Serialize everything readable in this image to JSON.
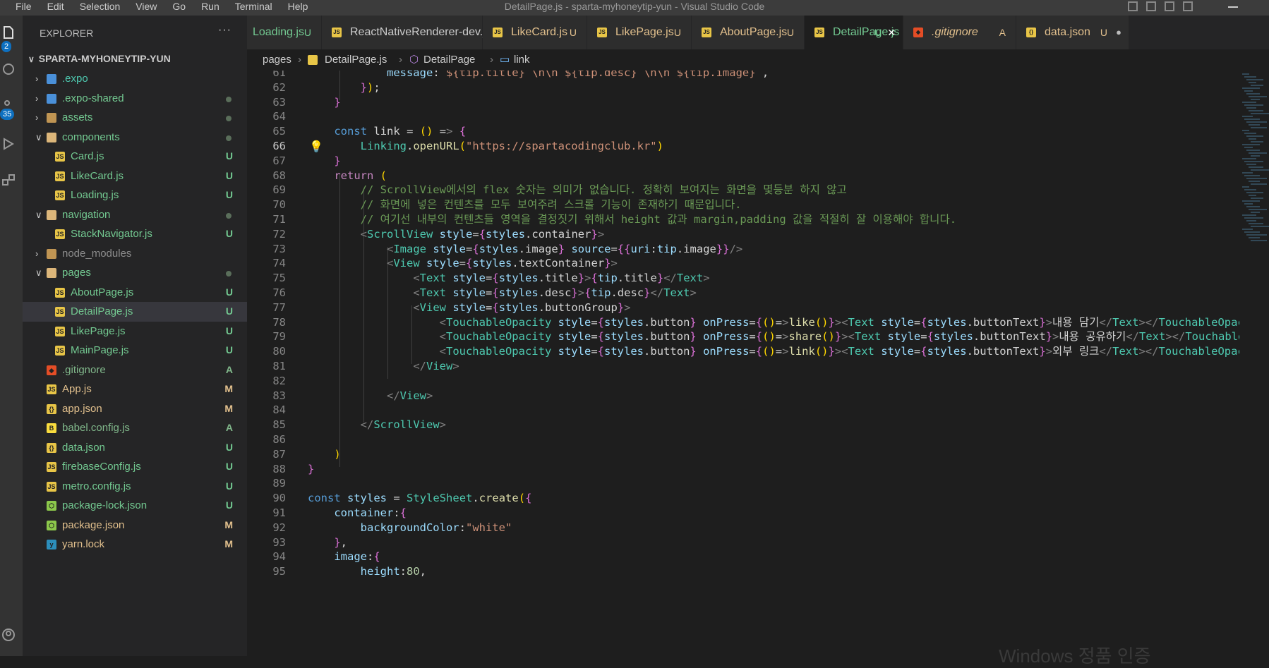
{
  "window": {
    "menu": [
      "File",
      "Edit",
      "Selection",
      "View",
      "Go",
      "Run",
      "Terminal",
      "Help"
    ],
    "title": "DetailPage.js - sparta-myhoneytip-yun - Visual Studio Code"
  },
  "activity_bar": {
    "explorer_badge": "2",
    "scm_badge": "35"
  },
  "sidebar": {
    "header": "EXPLORER",
    "more": "···",
    "project": "SPARTA-MYHONEYTIP-YUN",
    "items": [
      {
        "label": ".expo",
        "status": "",
        "dot": false,
        "color": "#4ec9b0",
        "icon": "expo-folder-icon"
      },
      {
        "label": ".expo-shared",
        "status": "",
        "dot": true,
        "color": "#73c991",
        "icon": "expo-folder-icon"
      },
      {
        "label": "assets",
        "status": "",
        "dot": true,
        "color": "#73c991",
        "icon": "folder-icon"
      },
      {
        "label": "components",
        "status": "",
        "dot": true,
        "color": "#73c991",
        "icon": "folder-open-icon"
      },
      {
        "label": "Card.js",
        "status": "U",
        "dot": false,
        "color": "#73c991",
        "icon": "js-file-icon"
      },
      {
        "label": "LikeCard.js",
        "status": "U",
        "dot": false,
        "color": "#73c991",
        "icon": "js-file-icon"
      },
      {
        "label": "Loading.js",
        "status": "U",
        "dot": false,
        "color": "#73c991",
        "icon": "js-file-icon"
      },
      {
        "label": "navigation",
        "status": "",
        "dot": true,
        "color": "#73c991",
        "icon": "folder-open-icon"
      },
      {
        "label": "StackNavigator.js",
        "status": "U",
        "dot": false,
        "color": "#73c991",
        "icon": "js-file-icon"
      },
      {
        "label": "node_modules",
        "status": "",
        "dot": false,
        "color": "#8c8c8c",
        "icon": "folder-icon"
      },
      {
        "label": "pages",
        "status": "",
        "dot": true,
        "color": "#73c991",
        "icon": "folder-open-icon"
      },
      {
        "label": "AboutPage.js",
        "status": "U",
        "dot": false,
        "color": "#73c991",
        "icon": "js-file-icon"
      },
      {
        "label": "DetailPage.js",
        "status": "U",
        "dot": false,
        "color": "#73c991",
        "icon": "js-file-icon"
      },
      {
        "label": "LikePage.js",
        "status": "U",
        "dot": false,
        "color": "#73c991",
        "icon": "js-file-icon"
      },
      {
        "label": "MainPage.js",
        "status": "U",
        "dot": false,
        "color": "#73c991",
        "icon": "js-file-icon"
      },
      {
        "label": ".gitignore",
        "status": "A",
        "dot": false,
        "color": "#81b88b",
        "icon": "git-icon"
      },
      {
        "label": "App.js",
        "status": "M",
        "dot": false,
        "color": "#e2c08d",
        "icon": "js-file-icon"
      },
      {
        "label": "app.json",
        "status": "M",
        "dot": false,
        "color": "#e2c08d",
        "icon": "json-file-icon"
      },
      {
        "label": "babel.config.js",
        "status": "A",
        "dot": false,
        "color": "#81b88b",
        "icon": "babel-icon"
      },
      {
        "label": "data.json",
        "status": "U",
        "dot": false,
        "color": "#73c991",
        "icon": "json-file-icon"
      },
      {
        "label": "firebaseConfig.js",
        "status": "U",
        "dot": false,
        "color": "#73c991",
        "icon": "js-file-icon"
      },
      {
        "label": "metro.config.js",
        "status": "U",
        "dot": false,
        "color": "#73c991",
        "icon": "js-file-icon"
      },
      {
        "label": "package-lock.json",
        "status": "U",
        "dot": false,
        "color": "#73c991",
        "icon": "node-icon"
      },
      {
        "label": "package.json",
        "status": "M",
        "dot": false,
        "color": "#e2c08d",
        "icon": "node-icon"
      },
      {
        "label": "yarn.lock",
        "status": "M",
        "dot": false,
        "color": "#e2c08d",
        "icon": "yarn-icon"
      }
    ]
  },
  "tabs": [
    {
      "label": "Loading.js",
      "status": "U"
    },
    {
      "label": "ReactNativeRenderer-dev.js",
      "status": ""
    },
    {
      "label": "LikeCard.js",
      "status": "U"
    },
    {
      "label": "LikePage.js",
      "status": "U"
    },
    {
      "label": "AboutPage.js",
      "status": "U"
    },
    {
      "label": "DetailPage.js",
      "status": "U",
      "close": "✕"
    },
    {
      "label": ".gitignore",
      "status": "A"
    },
    {
      "label": "data.json",
      "status": "U",
      "dot": "●"
    }
  ],
  "breadcrumb": {
    "folder": "pages",
    "file": "DetailPage.js",
    "symbol": "DetailPage",
    "member": "link"
  },
  "editor": {
    "current_line": 66,
    "line_numbers": [
      61,
      62,
      63,
      64,
      65,
      66,
      67,
      68,
      69,
      70,
      71,
      72,
      73,
      74,
      75,
      76,
      77,
      78,
      79,
      80,
      81,
      82,
      83,
      84,
      85,
      86,
      87,
      88,
      89,
      90,
      91,
      92,
      93,
      94,
      95
    ],
    "lines": [
      "            message:`${tip.title} \\n\\n ${tip.desc} \\n\\n ${tip.image}`,",
      "        });",
      "    }",
      "",
      "    const link = () => {",
      "        Linking.openURL(\"https://spartacodingclub.kr\")",
      "    }",
      "    return (",
      "        // ScrollView에서의 flex 숫자는 의미가 없습니다. 정확히 보여지는 화면을 몇등분 하지 않고",
      "        // 화면에 넣은 컨텐츠를 모두 보여주려 스크롤 기능이 존재하기 때문입니다.",
      "        // 여기선 내부의 컨텐츠들 영역을 결정짓기 위해서 height 값과 margin,padding 값을 적절히 잘 이용해야 합니다.",
      "        <ScrollView style={styles.container}>",
      "            <Image style={styles.image} source={{uri:tip.image}}/>",
      "            <View style={styles.textContainer}>",
      "                <Text style={styles.title}>{tip.title}</Text>",
      "                <Text style={styles.desc}>{tip.desc}</Text>",
      "                <View style={styles.buttonGroup}>",
      "                    <TouchableOpacity style={styles.button} onPress={()=>like()}><Text style={styles.buttonText}>내용 담기</Text></TouchableOpacity>",
      "                    <TouchableOpacity style={styles.button} onPress={()=>share()}><Text style={styles.buttonText}>내용 공유하기</Text></TouchableOpacity>",
      "                    <TouchableOpacity style={styles.button} onPress={()=>link()}><Text style={styles.buttonText}>외부 링크</Text></TouchableOpacity>",
      "                </View>",
      "",
      "            </View>",
      "",
      "        </ScrollView>",
      "",
      "    )",
      "}",
      "",
      "const styles = StyleSheet.create({",
      "    container:{",
      "        backgroundColor:\"white\"",
      "    },",
      "    image:{",
      "        height:80,"
    ]
  },
  "watermark": "Windows 정품 인증"
}
